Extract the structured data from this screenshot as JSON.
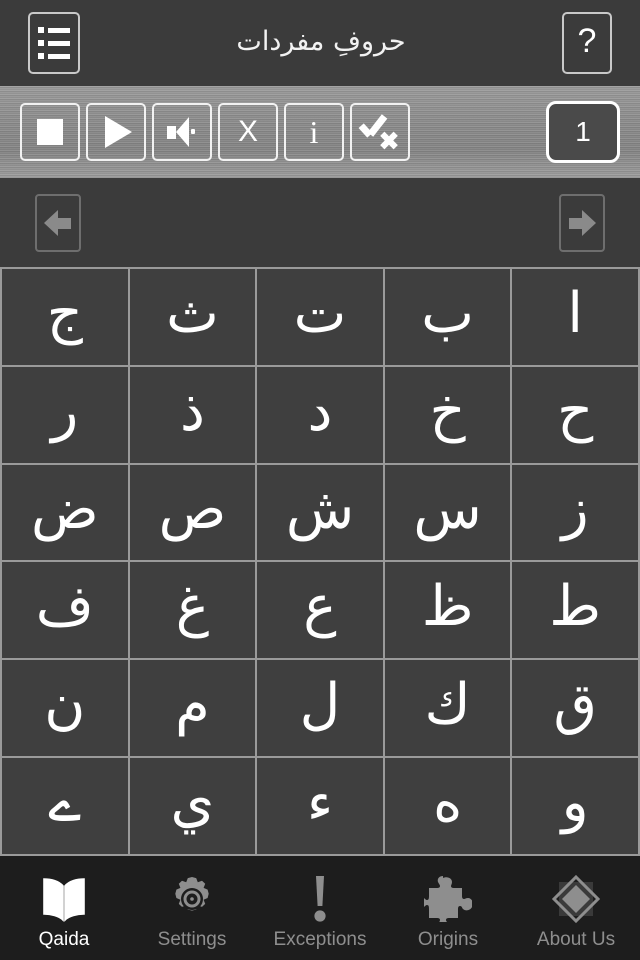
{
  "header": {
    "menu_icon": "list-icon",
    "title": "حروفِ مفردات",
    "help_label": "?"
  },
  "toolbar": {
    "buttons": [
      {
        "name": "stop-button",
        "icon": "stop-icon",
        "label": ""
      },
      {
        "name": "play-button",
        "icon": "play-icon",
        "label": ""
      },
      {
        "name": "sound-button",
        "icon": "speaker-icon",
        "label": ""
      },
      {
        "name": "close-button",
        "icon": "x-icon",
        "label": "X"
      },
      {
        "name": "info-button",
        "icon": "info-icon",
        "label": "i"
      },
      {
        "name": "check-clear-button",
        "icon": "check-x-icon",
        "label": ""
      }
    ],
    "page_number": "1"
  },
  "navigation": {
    "prev_icon": "arrow-left-icon",
    "next_icon": "arrow-right-icon"
  },
  "grid": {
    "rows": [
      [
        "ا",
        "ب",
        "ت",
        "ث",
        "ج"
      ],
      [
        "ح",
        "خ",
        "د",
        "ذ",
        "ر"
      ],
      [
        "ز",
        "س",
        "ش",
        "ص",
        "ض"
      ],
      [
        "ط",
        "ظ",
        "ع",
        "غ",
        "ف"
      ],
      [
        "ق",
        "ك",
        "ل",
        "م",
        "ن"
      ],
      [
        "و",
        "ه",
        "ء",
        "ي",
        "ے"
      ]
    ]
  },
  "tabbar": {
    "items": [
      {
        "label": "Qaida",
        "icon": "book-icon",
        "active": true
      },
      {
        "label": "Settings",
        "icon": "gear-icon",
        "active": false
      },
      {
        "label": "Exceptions",
        "icon": "exclamation-icon",
        "active": false
      },
      {
        "label": "Origins",
        "icon": "puzzle-piece-icon",
        "active": false
      },
      {
        "label": "About Us",
        "icon": "diamond-icon",
        "active": false
      }
    ]
  },
  "colors": {
    "header_bg": "#3b3b3b",
    "toolbar_bg": "#8d8d8d",
    "cell_bg": "#3f3f3f",
    "grid_line": "#9a9a9a",
    "tabbar_bg": "#1d1d1d",
    "active_text": "#ffffff",
    "inactive_text": "#8e8e8e"
  }
}
